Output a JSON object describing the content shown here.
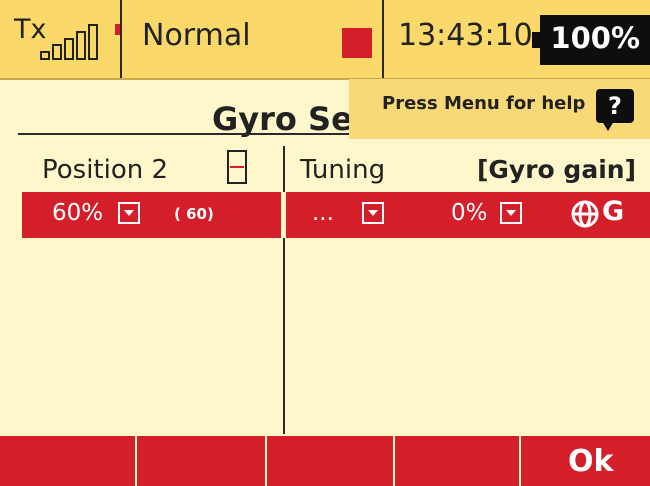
{
  "status": {
    "tx_label": "Tx",
    "signal_icon": "signal-bars-icon",
    "mode": "Normal",
    "indicator_color": "#d41e2a",
    "time": "13:43:10",
    "battery": "100%"
  },
  "screen": {
    "title": "Gyro Se",
    "help_tip": "Press Menu for help",
    "help_icon_glyph": "?"
  },
  "columns": {
    "left_header": "Position 2",
    "mid_header": "Tuning",
    "right_header": "[Gyro gain]"
  },
  "row": {
    "value1": "60%",
    "value1_paren": "( 60)",
    "value2": "...",
    "value3": "0%",
    "gyro_label": "G"
  },
  "softkeys": [
    "",
    "",
    "",
    "",
    "Ok"
  ],
  "colors": {
    "status_bg": "#fad86a",
    "page_bg": "#fff7cc",
    "accent_red": "#d41e2a",
    "dark": "#0e0e0e"
  }
}
